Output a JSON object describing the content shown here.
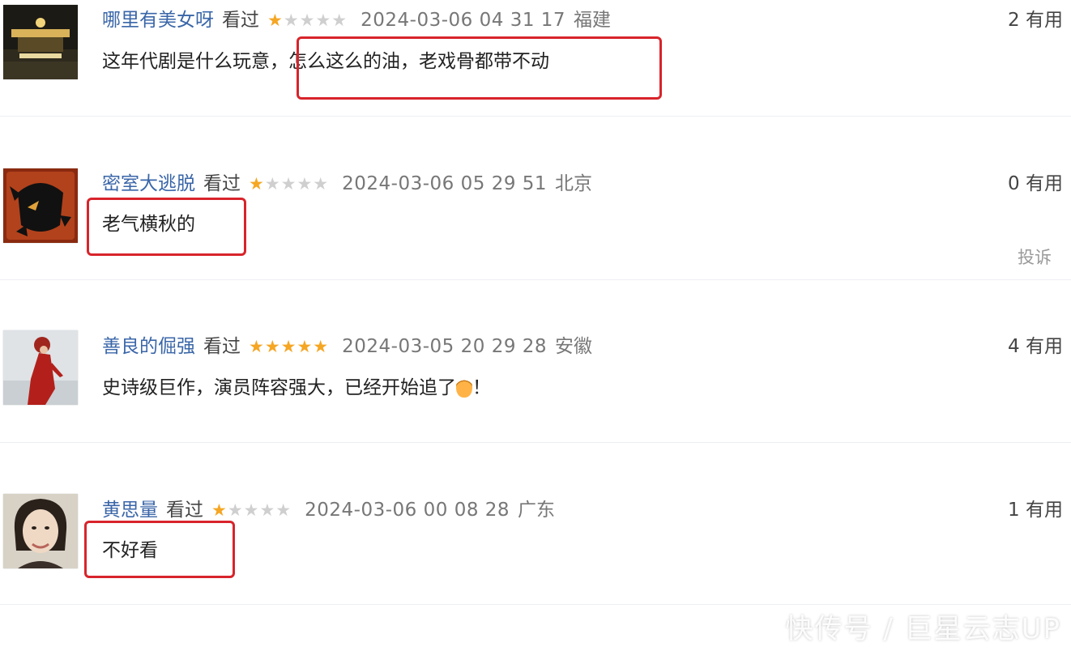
{
  "comments": [
    {
      "user": "哪里有美女呀",
      "status": "看过",
      "rating": 1,
      "time": "2024-03-06 04 31 17",
      "region": "福建",
      "useful": "2 有用",
      "text_before": "这年代剧是什么玩意，",
      "text_highlight": "怎么这么的油，老戏骨都带不动",
      "avatar_icon": "night-building-avatar"
    },
    {
      "user": "密室大逃脱",
      "status": "看过",
      "rating": 1,
      "time": "2024-03-06 05 29 51",
      "region": "北京",
      "useful": "0 有用",
      "text_highlight": "老气横秋的",
      "report": "投诉",
      "avatar_icon": "escape-game-avatar"
    },
    {
      "user": "善良的倔强",
      "status": "看过",
      "rating": 5,
      "time": "2024-03-05 20 29 28",
      "region": "安徽",
      "useful": "4 有用",
      "text": "史诗级巨作，演员阵容强大，已经开始追了",
      "text_end": "！",
      "avatar_icon": "red-dress-woman-avatar"
    },
    {
      "user": "黄思量",
      "status": "看过",
      "rating": 1,
      "time": "2024-03-06 00 08 28",
      "region": "广东",
      "useful": "1 有用",
      "text_highlight": "不好看",
      "avatar_icon": "vintage-woman-portrait-avatar"
    }
  ],
  "watermark": "快传号 / 巨星云志UP",
  "colors": {
    "username": "#3a66a8",
    "star_on": "#f5a623",
    "star_off": "#cfcfcf",
    "highlight_box": "#d8242b"
  }
}
